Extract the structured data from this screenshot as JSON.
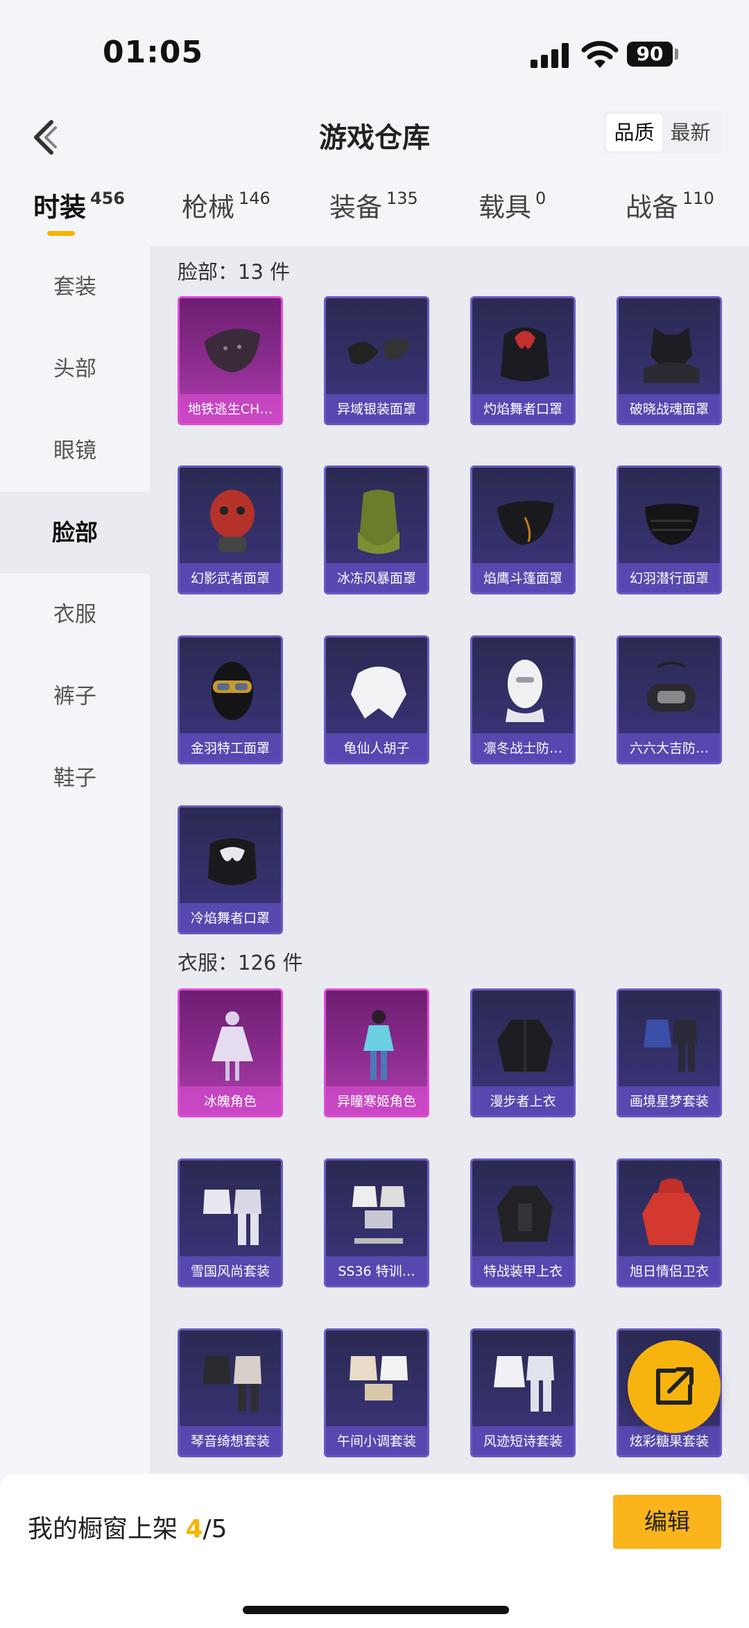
{
  "status": {
    "time": "01:05",
    "battery": "90"
  },
  "header": {
    "title": "游戏仓库",
    "sort": [
      "品质",
      "最新"
    ]
  },
  "categories": [
    {
      "label": "时装",
      "count": "456"
    },
    {
      "label": "枪械",
      "count": "146"
    },
    {
      "label": "装备",
      "count": "135"
    },
    {
      "label": "载具",
      "count": "0"
    },
    {
      "label": "战备",
      "count": "110"
    }
  ],
  "sidebar": [
    "套装",
    "头部",
    "眼镜",
    "脸部",
    "衣服",
    "裤子",
    "鞋子"
  ],
  "sections": [
    {
      "title": "脸部：13 件",
      "items": [
        "地铁逃生CH…",
        "异域银装面罩",
        "灼焰舞者口罩",
        "破晓战魂面罩",
        "幻影武者面罩",
        "冰冻风暴面罩",
        "焰鹰斗篷面罩",
        "幻羽潜行面罩",
        "金羽特工面罩",
        "龟仙人胡子",
        "凛冬战士防…",
        "六六大吉防…",
        "冷焰舞者口罩"
      ]
    },
    {
      "title": "衣服：126 件",
      "items": [
        "冰魄角色",
        "异瞳寒姬角色",
        "漫步者上衣",
        "画境星梦套装",
        "雪国风尚套装",
        "SS36 特训…",
        "特战装甲上衣",
        "旭日情侣卫衣",
        "琴音绮想套装",
        "午间小调套装",
        "风迹短诗套装",
        "炫彩糖果套装"
      ]
    }
  ],
  "bottom": {
    "label": "我的橱窗上架 ",
    "current": "4",
    "total": "/5",
    "edit": "编辑"
  }
}
